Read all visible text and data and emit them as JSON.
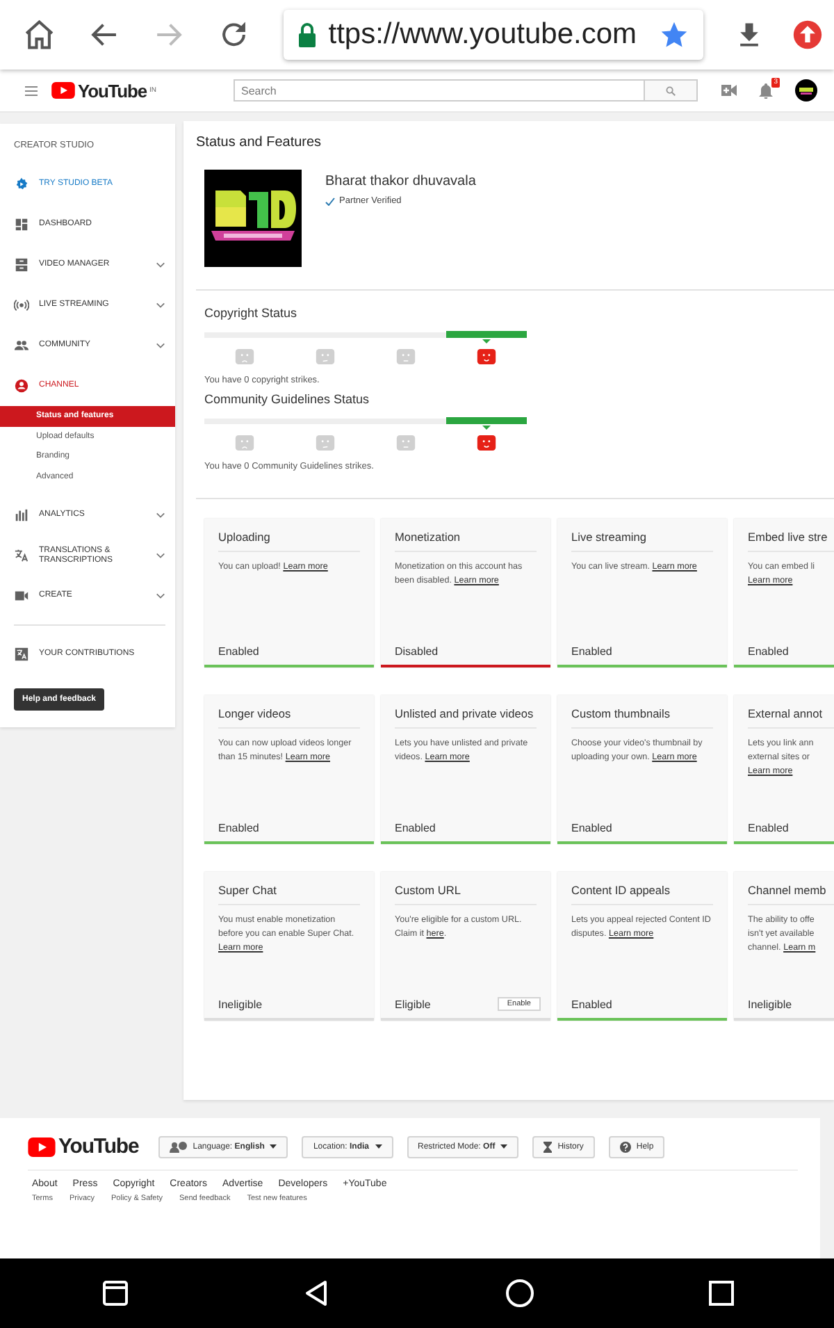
{
  "browser": {
    "url": "ttps://www.youtube.com",
    "forward_disabled": true
  },
  "header": {
    "logo": "YouTube",
    "region": "IN",
    "search": {
      "placeholder": "Search"
    },
    "notifications": "3"
  },
  "sidebar": {
    "heading": "CREATOR STUDIO",
    "items": [
      {
        "label": "TRY STUDIO BETA",
        "kind": "promo",
        "selected": false,
        "expandable": false
      },
      {
        "label": "DASHBOARD",
        "kind": "nav",
        "selected": false,
        "expandable": false
      },
      {
        "label": "VIDEO MANAGER",
        "kind": "nav",
        "selected": false,
        "expandable": true
      },
      {
        "label": "LIVE STREAMING",
        "kind": "nav",
        "selected": false,
        "expandable": true
      },
      {
        "label": "COMMUNITY",
        "kind": "nav",
        "selected": false,
        "expandable": true
      },
      {
        "label": "CHANNEL",
        "kind": "nav",
        "selected": true,
        "expandable": false,
        "children": [
          {
            "label": "Status and features",
            "selected": true
          },
          {
            "label": "Upload defaults",
            "selected": false
          },
          {
            "label": "Branding",
            "selected": false
          },
          {
            "label": "Advanced",
            "selected": false
          }
        ]
      },
      {
        "label": "ANALYTICS",
        "kind": "nav",
        "selected": false,
        "expandable": true
      },
      {
        "label": "TRANSLATIONS & TRANSCRIPTIONS",
        "kind": "nav",
        "selected": false,
        "expandable": true
      },
      {
        "label": "CREATE",
        "kind": "nav",
        "selected": false,
        "expandable": true
      },
      {
        "label": "YOUR CONTRIBUTIONS",
        "kind": "extra",
        "selected": false,
        "expandable": false
      }
    ],
    "button": "Help and feedback"
  },
  "main": {
    "title": "Status and Features",
    "channel": {
      "name": "Bharat thakor dhuvavala",
      "badge": "Partner Verified"
    },
    "statuses": [
      {
        "title": "Copyright Status",
        "levels": [
          {
            "kind": "sad",
            "selected": false
          },
          {
            "kind": "frown",
            "selected": false
          },
          {
            "kind": "neutral",
            "selected": false
          },
          {
            "kind": "smile",
            "selected": true
          }
        ],
        "note": "You have 0 copyright strikes."
      },
      {
        "title": "Community Guidelines Status",
        "levels": [
          {
            "kind": "sad",
            "selected": false
          },
          {
            "kind": "frown",
            "selected": false
          },
          {
            "kind": "neutral",
            "selected": false
          },
          {
            "kind": "smile",
            "selected": true
          }
        ],
        "note": "You have 0 Community Guidelines strikes."
      }
    ],
    "features": [
      {
        "kind": "full",
        "title": "Uploading",
        "text": "You can upload!",
        "link": "Learn more",
        "status": "Enabled",
        "color": "#6ac259"
      },
      {
        "kind": "full",
        "title": "Monetization",
        "text": "Monetization on this account has been disabled.",
        "link": "Learn more",
        "status": "Disabled",
        "color": "#cc181e"
      },
      {
        "kind": "full",
        "title": "Live streaming",
        "text": "You can live stream.",
        "link": "Learn more",
        "status": "Enabled",
        "color": "#6ac259"
      },
      {
        "kind": "cut",
        "title": "Embed live stre",
        "lines": [
          "You can embed li"
        ],
        "link": "Learn more",
        "link_inline": false,
        "status": "Enabled",
        "color": "#6ac259"
      },
      {
        "kind": "full",
        "title": "Longer videos",
        "text": "You can now upload videos longer than 15 minutes!",
        "link": "Learn more",
        "status": "Enabled",
        "color": "#6ac259"
      },
      {
        "kind": "full",
        "title": "Unlisted and private videos",
        "text": "Lets you have unlisted and private videos.",
        "link": "Learn more",
        "status": "Enabled",
        "color": "#6ac259"
      },
      {
        "kind": "full",
        "title": "Custom thumbnails",
        "text": "Choose your video's thumbnail by uploading your own.",
        "link": "Learn more",
        "status": "Enabled",
        "color": "#6ac259"
      },
      {
        "kind": "cut",
        "title": "External annot",
        "lines": [
          "Lets you link ann",
          "external sites or"
        ],
        "link": "Learn more",
        "link_inline": false,
        "status": "Enabled",
        "color": "#6ac259"
      },
      {
        "kind": "full",
        "title": "Super Chat",
        "text": "You must enable monetization before you can enable Super Chat.",
        "link": "Learn more",
        "status": "Ineligible",
        "color": "#dddddd"
      },
      {
        "kind": "full",
        "title": "Custom URL",
        "text": "You're eligible for a custom URL. Claim it",
        "link": "here",
        "after": ".",
        "status": "Eligible",
        "color": "#dddddd",
        "button": "Enable"
      },
      {
        "kind": "full",
        "title": "Content ID appeals",
        "text": "Lets you appeal rejected Content ID disputes.",
        "link": "Learn more",
        "status": "Enabled",
        "color": "#6ac259"
      },
      {
        "kind": "cut",
        "title": "Channel memb",
        "lines": [
          "The ability to offe",
          "isn't yet available",
          "channel."
        ],
        "link": "Learn m",
        "link_inline": true,
        "status": "Ineligible",
        "color": "#dddddd"
      }
    ]
  },
  "footer": {
    "logo": "YouTube",
    "pickers": [
      {
        "label": "Language:",
        "value": "English"
      },
      {
        "label": "Location:",
        "value": "India"
      },
      {
        "label": "Restricted Mode:",
        "value": "Off"
      }
    ],
    "buttons": [
      "History",
      "Help"
    ],
    "links": [
      "About",
      "Press",
      "Copyright",
      "Creators",
      "Advertise",
      "Developers",
      "+YouTube"
    ],
    "small_links": [
      "Terms",
      "Privacy",
      "Policy & Safety",
      "Send feedback",
      "Test new features"
    ]
  }
}
